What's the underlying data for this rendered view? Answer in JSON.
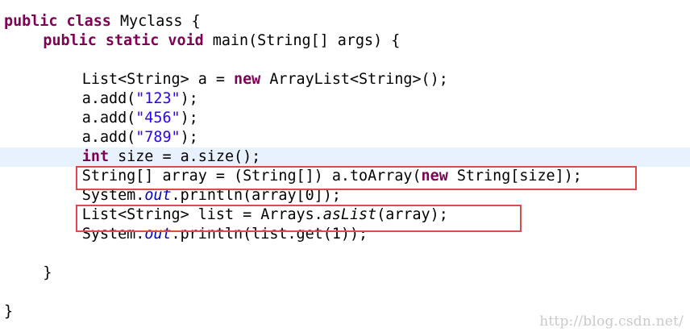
{
  "editor": {
    "lines": [
      {
        "indent": 0,
        "segments": [
          {
            "text": "public",
            "style": "kw"
          },
          {
            "text": " "
          },
          {
            "text": "class",
            "style": "kw"
          },
          {
            "text": " Myclass {"
          }
        ]
      },
      {
        "indent": 4,
        "segments": [
          {
            "text": "public",
            "style": "kw"
          },
          {
            "text": " "
          },
          {
            "text": "static",
            "style": "kw"
          },
          {
            "text": " "
          },
          {
            "text": "void",
            "style": "kw"
          },
          {
            "text": " main(String[] args) {"
          }
        ]
      },
      {
        "indent": 0,
        "segments": []
      },
      {
        "indent": 8,
        "segments": [
          {
            "text": "List<String> a = "
          },
          {
            "text": "new",
            "style": "kw"
          },
          {
            "text": " ArrayList<String>();"
          }
        ]
      },
      {
        "indent": 8,
        "segments": [
          {
            "text": "a.add("
          },
          {
            "text": "\"123\"",
            "style": "str"
          },
          {
            "text": ");"
          }
        ]
      },
      {
        "indent": 8,
        "segments": [
          {
            "text": "a.add("
          },
          {
            "text": "\"456\"",
            "style": "str"
          },
          {
            "text": ");"
          }
        ]
      },
      {
        "indent": 8,
        "segments": [
          {
            "text": "a.add("
          },
          {
            "text": "\"789\"",
            "style": "str"
          },
          {
            "text": ");"
          }
        ]
      },
      {
        "indent": 8,
        "current": true,
        "segments": [
          {
            "text": "int",
            "style": "kw"
          },
          {
            "text": " size = a.size();"
          }
        ]
      },
      {
        "indent": 8,
        "segments": [
          {
            "text": "String[] array = (String[]) a.toArray("
          },
          {
            "text": "new",
            "style": "kw"
          },
          {
            "text": " String[size]);"
          }
        ]
      },
      {
        "indent": 8,
        "segments": [
          {
            "text": "System."
          },
          {
            "text": "out",
            "style": "static-field"
          },
          {
            "text": ".println(array[0]);"
          }
        ]
      },
      {
        "indent": 8,
        "segments": [
          {
            "text": "List<String> list = Arrays."
          },
          {
            "text": "asList",
            "style": "static-method"
          },
          {
            "text": "(array);"
          }
        ]
      },
      {
        "indent": 8,
        "segments": [
          {
            "text": "System."
          },
          {
            "text": "out",
            "style": "static-field"
          },
          {
            "text": ".println(list.get(1));"
          }
        ]
      },
      {
        "indent": 0,
        "segments": []
      },
      {
        "indent": 4,
        "segments": [
          {
            "text": "}"
          }
        ]
      },
      {
        "indent": 0,
        "segments": []
      },
      {
        "indent": 0,
        "segments": [
          {
            "text": "}"
          }
        ]
      }
    ]
  },
  "watermark": "http://blog.csdn.net/",
  "colors": {
    "keyword": "#7f0055",
    "string": "#2a00ff",
    "static_field": "#0000c0",
    "current_line": "#e8f2fe",
    "highlight_box": "#e04a4a"
  }
}
